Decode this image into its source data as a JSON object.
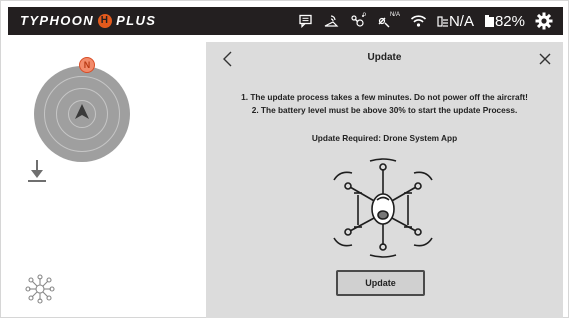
{
  "brand": {
    "name_part1": "TYPHOON",
    "logo_letter": "H",
    "name_part2": "PLUS"
  },
  "status": {
    "telemetry_icons": [
      "chat-bubble-icon",
      "satellite-signal-icon",
      "camera-drone-icon",
      "gps-icon",
      "wifi-icon"
    ],
    "gps_superscript": "N/A",
    "signal_text": "N/A",
    "battery_text": "82%",
    "settings_icon": "gear-icon"
  },
  "compass": {
    "north_label": "N"
  },
  "update_dialog": {
    "title": "Update",
    "instruction_1": "1. The update process takes a few minutes. Do not power off the aircraft!",
    "instruction_2": "2. The battery level must be above 30% to start the update Process.",
    "required_text": "Update Required: Drone System App",
    "button_label": "Update"
  },
  "colors": {
    "topbar": "#231f20",
    "accent": "#e35a1c",
    "panel": "#dcdcdc"
  }
}
